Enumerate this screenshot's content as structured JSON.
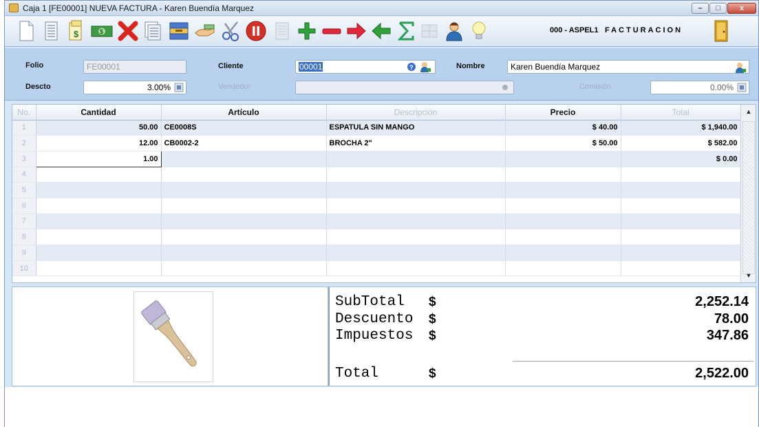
{
  "window": {
    "title": "Caja 1 [FE00001] NUEVA FACTURA - Karen Buendía Marquez",
    "minimize": "–",
    "maximize": "□",
    "close": "x"
  },
  "toolbar": {
    "company": "000 - ASPEL1",
    "module": "FACTURACION",
    "buttons": [
      "new-doc-icon",
      "document-list-icon",
      "currency-doc-icon",
      "cash-icon",
      "cancel-x-icon",
      "print-docs-icon",
      "save-drawer-icon",
      "hand-payment-icon",
      "scissors-icon",
      "pause-icon",
      "receipt-disabled-icon",
      "add-plus-icon",
      "remove-minus-icon",
      "arrow-right-icon",
      "arrow-left-icon",
      "sum-icon",
      "grid-disabled-icon",
      "user-icon",
      "lightbulb-icon",
      "exit-door-icon"
    ]
  },
  "header": {
    "folio_label": "Folio",
    "folio_value": "FE00001",
    "cliente_label": "Cliente",
    "cliente_value": "00001",
    "nombre_label": "Nombre",
    "nombre_value": "Karen Buendía Marquez",
    "descto_label": "Descto",
    "descto_value": "3.00%",
    "vendedor_label": "Vendedor",
    "vendedor_value": "",
    "comision_label": "Comisión",
    "comision_value": "0.00%"
  },
  "grid": {
    "columns": [
      "No.",
      "Cantidad",
      "Artículo",
      "Descripción",
      "Precio",
      "Total"
    ],
    "rows": [
      {
        "no": "1",
        "cantidad": "50.00",
        "articulo": "CE0008S",
        "descripcion": "ESPATULA SIN MANGO",
        "precio": "$ 40.00",
        "total": "$ 1,940.00"
      },
      {
        "no": "2",
        "cantidad": "12.00",
        "articulo": "CB0002-2",
        "descripcion": "BROCHA 2\"",
        "precio": "$ 50.00",
        "total": "$ 582.00"
      },
      {
        "no": "3",
        "cantidad": "1.00",
        "articulo": "",
        "descripcion": "",
        "precio": "",
        "total": "$ 0.00"
      },
      {
        "no": "4",
        "cantidad": "",
        "articulo": "",
        "descripcion": "",
        "precio": "",
        "total": ""
      },
      {
        "no": "5",
        "cantidad": "",
        "articulo": "",
        "descripcion": "",
        "precio": "",
        "total": ""
      },
      {
        "no": "6",
        "cantidad": "",
        "articulo": "",
        "descripcion": "",
        "precio": "",
        "total": ""
      },
      {
        "no": "7",
        "cantidad": "",
        "articulo": "",
        "descripcion": "",
        "precio": "",
        "total": ""
      },
      {
        "no": "8",
        "cantidad": "",
        "articulo": "",
        "descripcion": "",
        "precio": "",
        "total": ""
      },
      {
        "no": "9",
        "cantidad": "",
        "articulo": "",
        "descripcion": "",
        "precio": "",
        "total": ""
      },
      {
        "no": "10",
        "cantidad": "",
        "articulo": "",
        "descripcion": "",
        "precio": "",
        "total": ""
      }
    ]
  },
  "totals": {
    "subtotal_label": "SubTotal",
    "subtotal_value": "2,252.14",
    "descuento_label": "Descuento",
    "descuento_value": "78.00",
    "impuestos_label": "Impuestos",
    "impuestos_value": "347.86",
    "total_label": "Total",
    "total_value": "2,522.00",
    "currency": "$"
  }
}
